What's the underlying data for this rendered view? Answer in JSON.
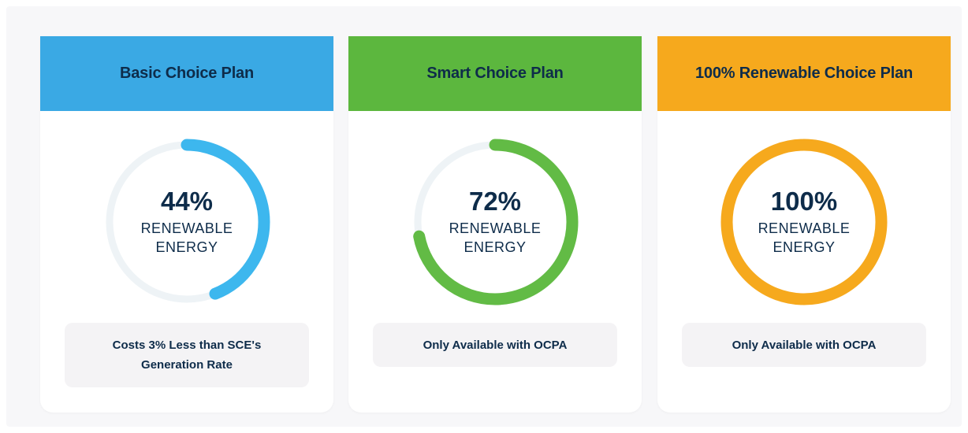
{
  "plans": [
    {
      "title": "Basic Choice Plan",
      "header_color": "#3aa9e4",
      "ring_color": "#3db7ee",
      "track_color": "#eef3f6",
      "percent_value": 44,
      "percent_label": "44%",
      "renewable_line1": "RENEWABLE",
      "renewable_line2": "ENERGY",
      "note_line1": "Costs 3% Less than SCE's",
      "note_line2": "Generation Rate"
    },
    {
      "title": "Smart Choice Plan",
      "header_color": "#5cb73e",
      "ring_color": "#62bb45",
      "track_color": "#eef3f6",
      "percent_value": 72,
      "percent_label": "72%",
      "renewable_line1": "RENEWABLE",
      "renewable_line2": "ENERGY",
      "note_line1": "Only Available with OCPA",
      "note_line2": ""
    },
    {
      "title": "100% Renewable Choice Plan",
      "header_color": "#f6a91d",
      "ring_color": "#f6a91d",
      "track_color": "#eef3f6",
      "percent_value": 100,
      "percent_label": "100%",
      "renewable_line1": "RENEWABLE",
      "renewable_line2": "ENERGY",
      "note_line1": "Only Available with OCPA",
      "note_line2": ""
    }
  ]
}
